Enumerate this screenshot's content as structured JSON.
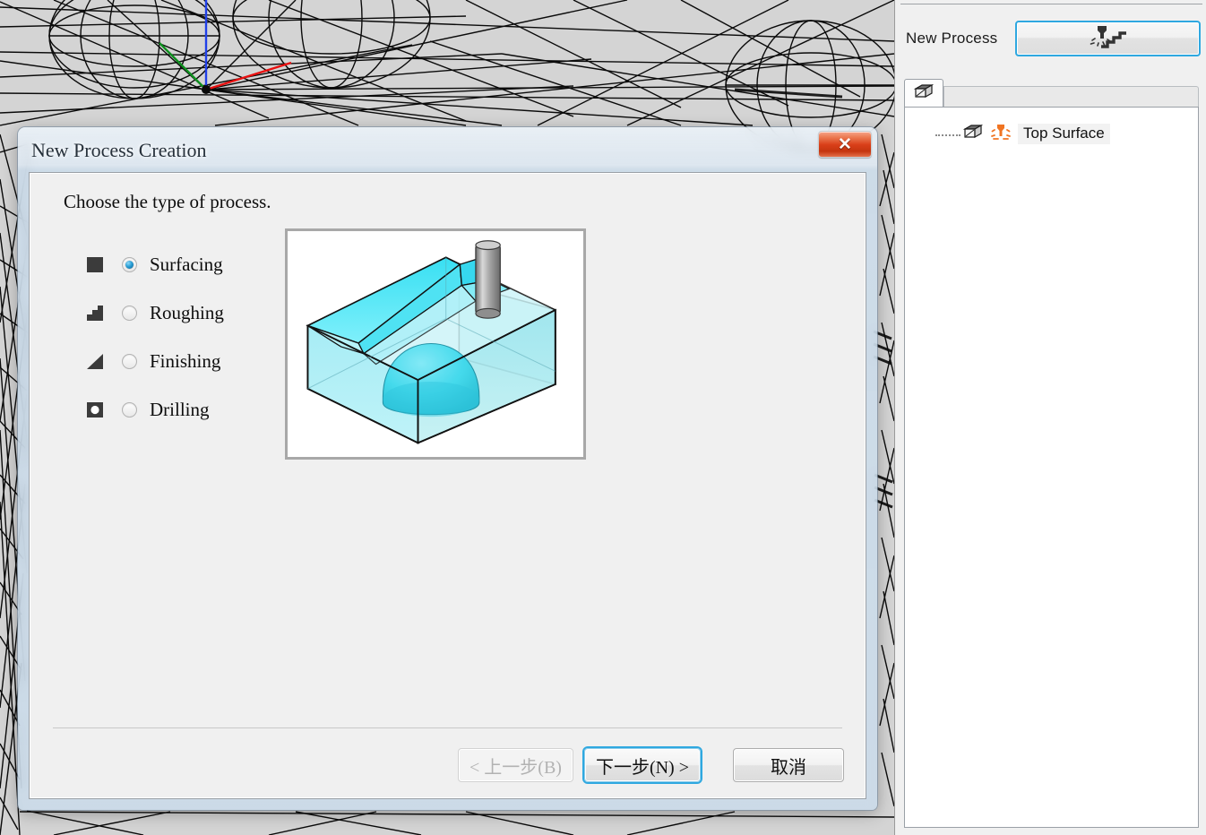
{
  "app": {
    "viewport_background": "#d4d4d4",
    "accent_color": "#2fa8e0"
  },
  "right_panel": {
    "new_process_label": "New Process",
    "new_process_button_icon": "cutting-tool-step-icon",
    "tab_icon": "3d-box-icon",
    "tree": {
      "items": [
        {
          "label": "Top Surface",
          "box_icon": "3d-box-icon",
          "tool_icon": "orange-tool-icon"
        }
      ]
    }
  },
  "dialog": {
    "title": "New Process Creation",
    "close_label": "✕",
    "prompt": "Choose the type of process.",
    "options": [
      {
        "label": "Surfacing",
        "icon": "solid-square-icon",
        "selected": true
      },
      {
        "label": "Roughing",
        "icon": "staircase-step-icon",
        "selected": false
      },
      {
        "label": "Finishing",
        "icon": "right-triangle-icon",
        "selected": false
      },
      {
        "label": "Drilling",
        "icon": "square-with-hole-icon",
        "selected": false
      }
    ],
    "preview": {
      "description": "surfacing-operation-preview",
      "block_color": "#5fe4f2",
      "tool_color": "#9a9a9a"
    },
    "buttons": {
      "back": "< 上一步(B)",
      "next": "下一步(N) >",
      "cancel": "取消"
    }
  }
}
